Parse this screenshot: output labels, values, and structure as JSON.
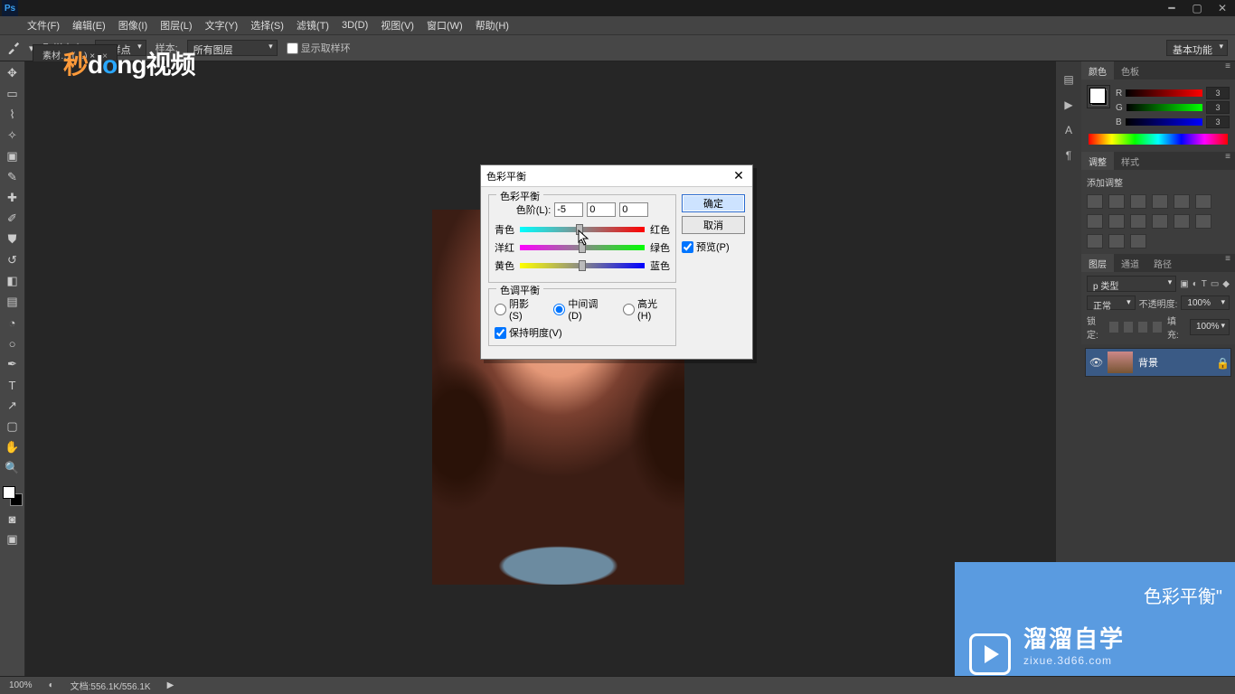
{
  "menubar": [
    "文件(F)",
    "编辑(E)",
    "图像(I)",
    "图层(L)",
    "文字(Y)",
    "选择(S)",
    "滤镜(T)",
    "3D(D)",
    "视图(V)",
    "窗口(W)",
    "帮助(H)"
  ],
  "optbar": {
    "sampleSizeLabel": "取样大小:",
    "sampleSizeValue": "取样点",
    "sampleLabel": "样本:",
    "sampleValue": "所有图层",
    "showRing": "显示取样环",
    "right": "基本功能"
  },
  "docTab": "素材… (…) ×",
  "watermark": {
    "a": "秒",
    "b": "d",
    "c": "o",
    "d": "ng",
    "e": "视频"
  },
  "colorPanel": {
    "tabs": [
      "颜色",
      "色板"
    ],
    "r": {
      "label": "R",
      "val": "3"
    },
    "g": {
      "label": "G",
      "val": "3"
    },
    "b": {
      "label": "B",
      "val": "3"
    }
  },
  "adjustPanel": {
    "tabs": [
      "调整",
      "样式"
    ],
    "label": "添加调整"
  },
  "layersPanel": {
    "tabs": [
      "图层",
      "通道",
      "路径"
    ],
    "kind": "p 类型",
    "mode": "正常",
    "opacityLabel": "不透明度:",
    "opacity": "100%",
    "lockLabel": "锁定:",
    "fillLabel": "填充:",
    "fill": "100%",
    "layer": {
      "name": "背景"
    }
  },
  "dialog": {
    "title": "色彩平衡",
    "group1": "色彩平衡",
    "levelsLabel": "色阶(L):",
    "v1": "-5",
    "v2": "0",
    "v3": "0",
    "cyan": "青色",
    "red": "红色",
    "magenta": "洋红",
    "green": "绿色",
    "yellow": "黄色",
    "blue": "蓝色",
    "group2": "色调平衡",
    "shadows": "阴影(S)",
    "midtones": "中间调(D)",
    "highlights": "高光(H)",
    "preserve": "保持明度(V)",
    "ok": "确定",
    "cancel": "取消",
    "preview": "预览(P)"
  },
  "status": {
    "zoom": "100%",
    "doc": "文档:556.1K/556.1K"
  },
  "overlay": {
    "brand": "溜溜自学",
    "url": "zixue.3d66.com",
    "tip": "色彩平衡\""
  }
}
